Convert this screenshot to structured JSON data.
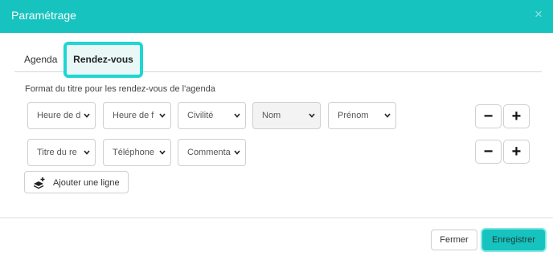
{
  "dialog": {
    "title": "Paramétrage",
    "close_glyph": "×"
  },
  "tabs": [
    {
      "label": "Agenda",
      "active": false
    },
    {
      "label": "Rendez-vous",
      "active": true
    }
  ],
  "section": {
    "label": "Format du titre pour les rendez-vous de l'agenda"
  },
  "rows": [
    {
      "fields": [
        "Heure de d",
        "Heure de f",
        "Civilité",
        "Nom",
        "Prénom"
      ]
    },
    {
      "fields": [
        "Titre du re",
        "Téléphone",
        "Commenta"
      ]
    }
  ],
  "row_buttons": {
    "minus": "−",
    "plus": "+"
  },
  "add_line": {
    "label": "Ajouter une ligne",
    "icon": "layers-plus-icon"
  },
  "footer": {
    "close_label": "Fermer",
    "save_label": "Enregistrer"
  },
  "colors": {
    "accent": "#16c3bf",
    "highlight": "#1fd6d3"
  }
}
